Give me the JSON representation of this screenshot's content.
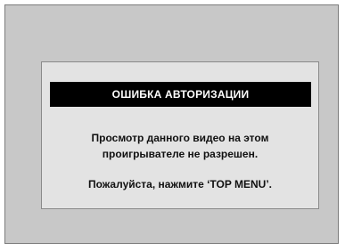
{
  "dialog": {
    "title": "ОШИБКА АВТОРИЗАЦИИ",
    "message_line1": "Просмотр данного видео на этом",
    "message_line2": "проигрывателе не разрешен.",
    "instruction": "Пожалуйста, нажмите ‘TOP MENU’."
  },
  "colors": {
    "screen_background": "#c8c8c8",
    "dialog_background": "#e3e3e3",
    "title_bar": "#000000",
    "title_text": "#ffffff"
  }
}
